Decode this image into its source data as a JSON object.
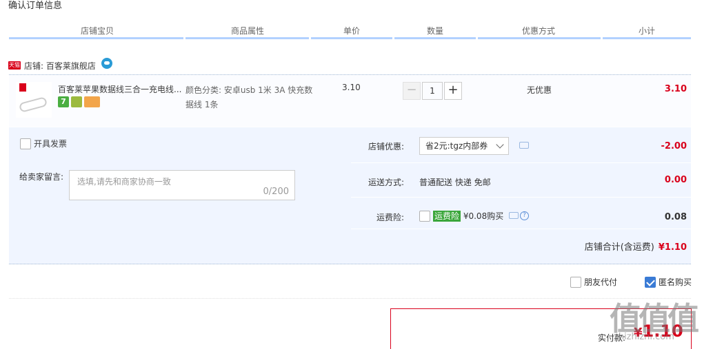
{
  "page": {
    "title": "确认订单信息"
  },
  "columns": [
    "店铺宝贝",
    "商品属性",
    "单价",
    "数量",
    "优惠方式",
    "小计"
  ],
  "shop": {
    "badge": "天猫",
    "label": "店铺: 百客莱旗舰店",
    "chat_icon": "wangwang-icon"
  },
  "item": {
    "name": "百客莱苹果数据线三合一充电线...",
    "properties": "颜色分类: 安卓usb 1米 3A 快充数据线 1条",
    "unit_price": "3.10",
    "quantity": "1",
    "minus": "−",
    "plus": "+",
    "service_badge": "7",
    "discount": "无优惠",
    "subtotal": "3.10"
  },
  "invoice": {
    "label": "开具发票",
    "checked": false
  },
  "message": {
    "label": "给卖家留言:",
    "placeholder": "选填,请先和商家协商一致",
    "counter": "0/200"
  },
  "store_discount": {
    "label": "店铺优惠:",
    "selected": "省2元:tgz内部券",
    "value": "-2.00"
  },
  "shipping": {
    "label": "运送方式:",
    "value_text": "普通配送 快递 免邮",
    "value": "0.00"
  },
  "insurance": {
    "label": "运费险:",
    "tag": "运费险",
    "text": "¥0.08购买",
    "value": "0.08",
    "help": "?"
  },
  "store_total": {
    "label": "店铺合计(含运费)",
    "value": "¥1.10"
  },
  "options": {
    "friend_pay": "朋友代付",
    "anonymous": "匿名购买",
    "anonymous_checked": true
  },
  "payment": {
    "label": "实付款:",
    "yen": "¥",
    "amount": "1.10"
  },
  "watermark": {
    "main": "值值值",
    "sub": "zhizhizhi.com"
  },
  "colors": {
    "accent_red": "#d9001b",
    "header_line": "#b2d1ff",
    "options_bg": "#f0f5ff",
    "insurance_green": "#3aa63a"
  }
}
